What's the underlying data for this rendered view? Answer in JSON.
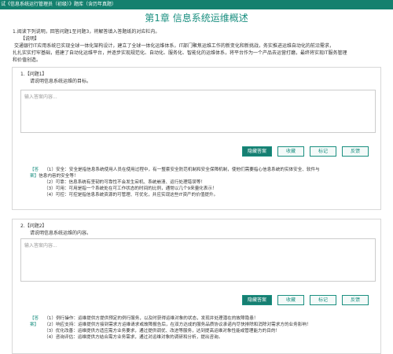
{
  "header": {
    "title": "试《信息系统运行管理员（初级）》题库（含历年真题）"
  },
  "chapter": {
    "title": "第1章   信息系统运维概述"
  },
  "intro": {
    "instruction": "1.阅读下列说明，回答问题1至问题3，将解答填入答题纸的对应栏内。",
    "heading": "【说明】",
    "lines": [
      "交通银行IT应用系统已实现全球一体化架构设计，建立了全球一体化运维体系，IT部门聚焦运维工作的新变化和新挑战，务实推进运维自动化的前沿需求，",
      "扎扎实实打牢基础，搭建了自动化运维平台，并逐步实现规范化、自动化、服务化、智能化的运维体系，将平台作为一个产品去运营打磨，最终将实现IT服务管理",
      "和价值创造。"
    ]
  },
  "questions": [
    {
      "title": "1.【问题1】",
      "prompt": "请说明信息系统运维的目标。",
      "placeholder": "输入答案内容...",
      "buttons": {
        "answer": "隐藏答案",
        "favorite": "收藏",
        "mark": "标记",
        "feedback": "反馈"
      },
      "reference": {
        "tag": "【答",
        "tag2": "案】",
        "lines": [
          "（1）安全：安全是指信息系统使用人员在使用过程中，有一整套安全防范机制和安全保障机制，使他们需要指心信息系统的实体安全、软件与",
          "信息内容的安全等！",
          "（2）可靠：信息系统有坚韧的可靠性不会发生宕机、系统崩溃、运行处理错误等！",
          "（3）可用：可用是指一个系统处在可工作状态的时间的比例，通常以几个9来量化表示！",
          "（4）可控：可控是指信息系统资源的可管理、可优化，并应实现这些IT资产的价值提升。"
        ]
      }
    },
    {
      "title": "2.【问题2】",
      "prompt": "请说明信息系统运维的内容。",
      "placeholder": "输入答案内容...",
      "buttons": {
        "answer": "隐藏答案",
        "favorite": "收藏",
        "mark": "标记",
        "feedback": "反馈"
      },
      "reference": {
        "tag": "【答",
        "tag2": "案】",
        "lines": [
          "（1）例行操作：运维提供方提供预定的例行服务，以及时获得运维对象的状态，发现并处理潜在的故障隐患！",
          "（2）响应支持：运维提供方接到需求方运维请求或故障报告后，在双方达成的服务品质协议承诺内尽快排除和消除对需求方的业务影响！",
          "（3）优化改善：运维提供方适应需方业务要求，通过提供调优、改进等服务，达到提高运维对象性能或管理能力的目的！",
          "（4）咨询评估：运维提供方结合需方业务需求，通过对运维对象的调研和分析，提出咨询。"
        ]
      }
    }
  ]
}
